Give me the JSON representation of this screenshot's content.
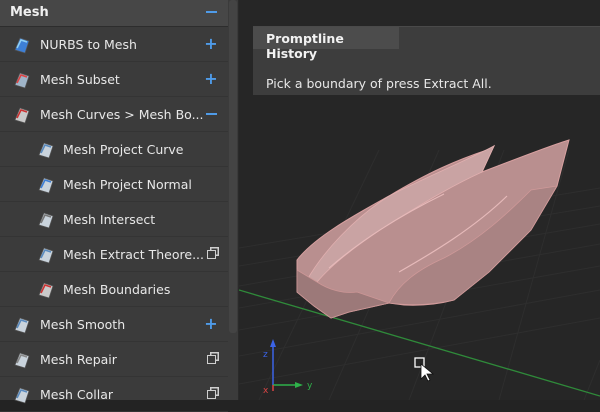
{
  "panel": {
    "title": "Mesh",
    "items": [
      {
        "label": "NURBS to Mesh",
        "icon": "nurbs-to-mesh-icon",
        "action": "add",
        "indent": 0
      },
      {
        "label": "Mesh Subset",
        "icon": "mesh-subset-icon",
        "action": "add",
        "indent": 0
      },
      {
        "label": "Mesh Curves > Mesh Bo...",
        "icon": "mesh-curves-icon",
        "action": "collapse",
        "indent": 0
      },
      {
        "label": "Mesh Project Curve",
        "icon": "mesh-project-curve-icon",
        "action": "none",
        "indent": 1
      },
      {
        "label": "Mesh Project Normal",
        "icon": "mesh-project-normal-icon",
        "action": "none",
        "indent": 1
      },
      {
        "label": "Mesh Intersect",
        "icon": "mesh-intersect-icon",
        "action": "none",
        "indent": 1
      },
      {
        "label": "Mesh Extract Theore...",
        "icon": "mesh-extract-icon",
        "action": "copy",
        "indent": 1
      },
      {
        "label": "Mesh Boundaries",
        "icon": "mesh-boundaries-icon",
        "action": "none",
        "indent": 1
      },
      {
        "label": "Mesh Smooth",
        "icon": "mesh-smooth-icon",
        "action": "add",
        "indent": 0
      },
      {
        "label": "Mesh Repair",
        "icon": "mesh-repair-icon",
        "action": "copy",
        "indent": 0
      },
      {
        "label": "Mesh Collar",
        "icon": "mesh-collar-icon",
        "action": "copy",
        "indent": 0
      }
    ]
  },
  "history": {
    "tab": "Promptline History",
    "message": "Pick a boundary of press Extract All."
  },
  "axes": {
    "x": "x",
    "y": "y",
    "z": "z"
  },
  "colors": {
    "accent": "#4f9be8",
    "mesh": "#c79a9a",
    "x_axis": "#2fb14a",
    "z_axis": "#3b63e6"
  }
}
